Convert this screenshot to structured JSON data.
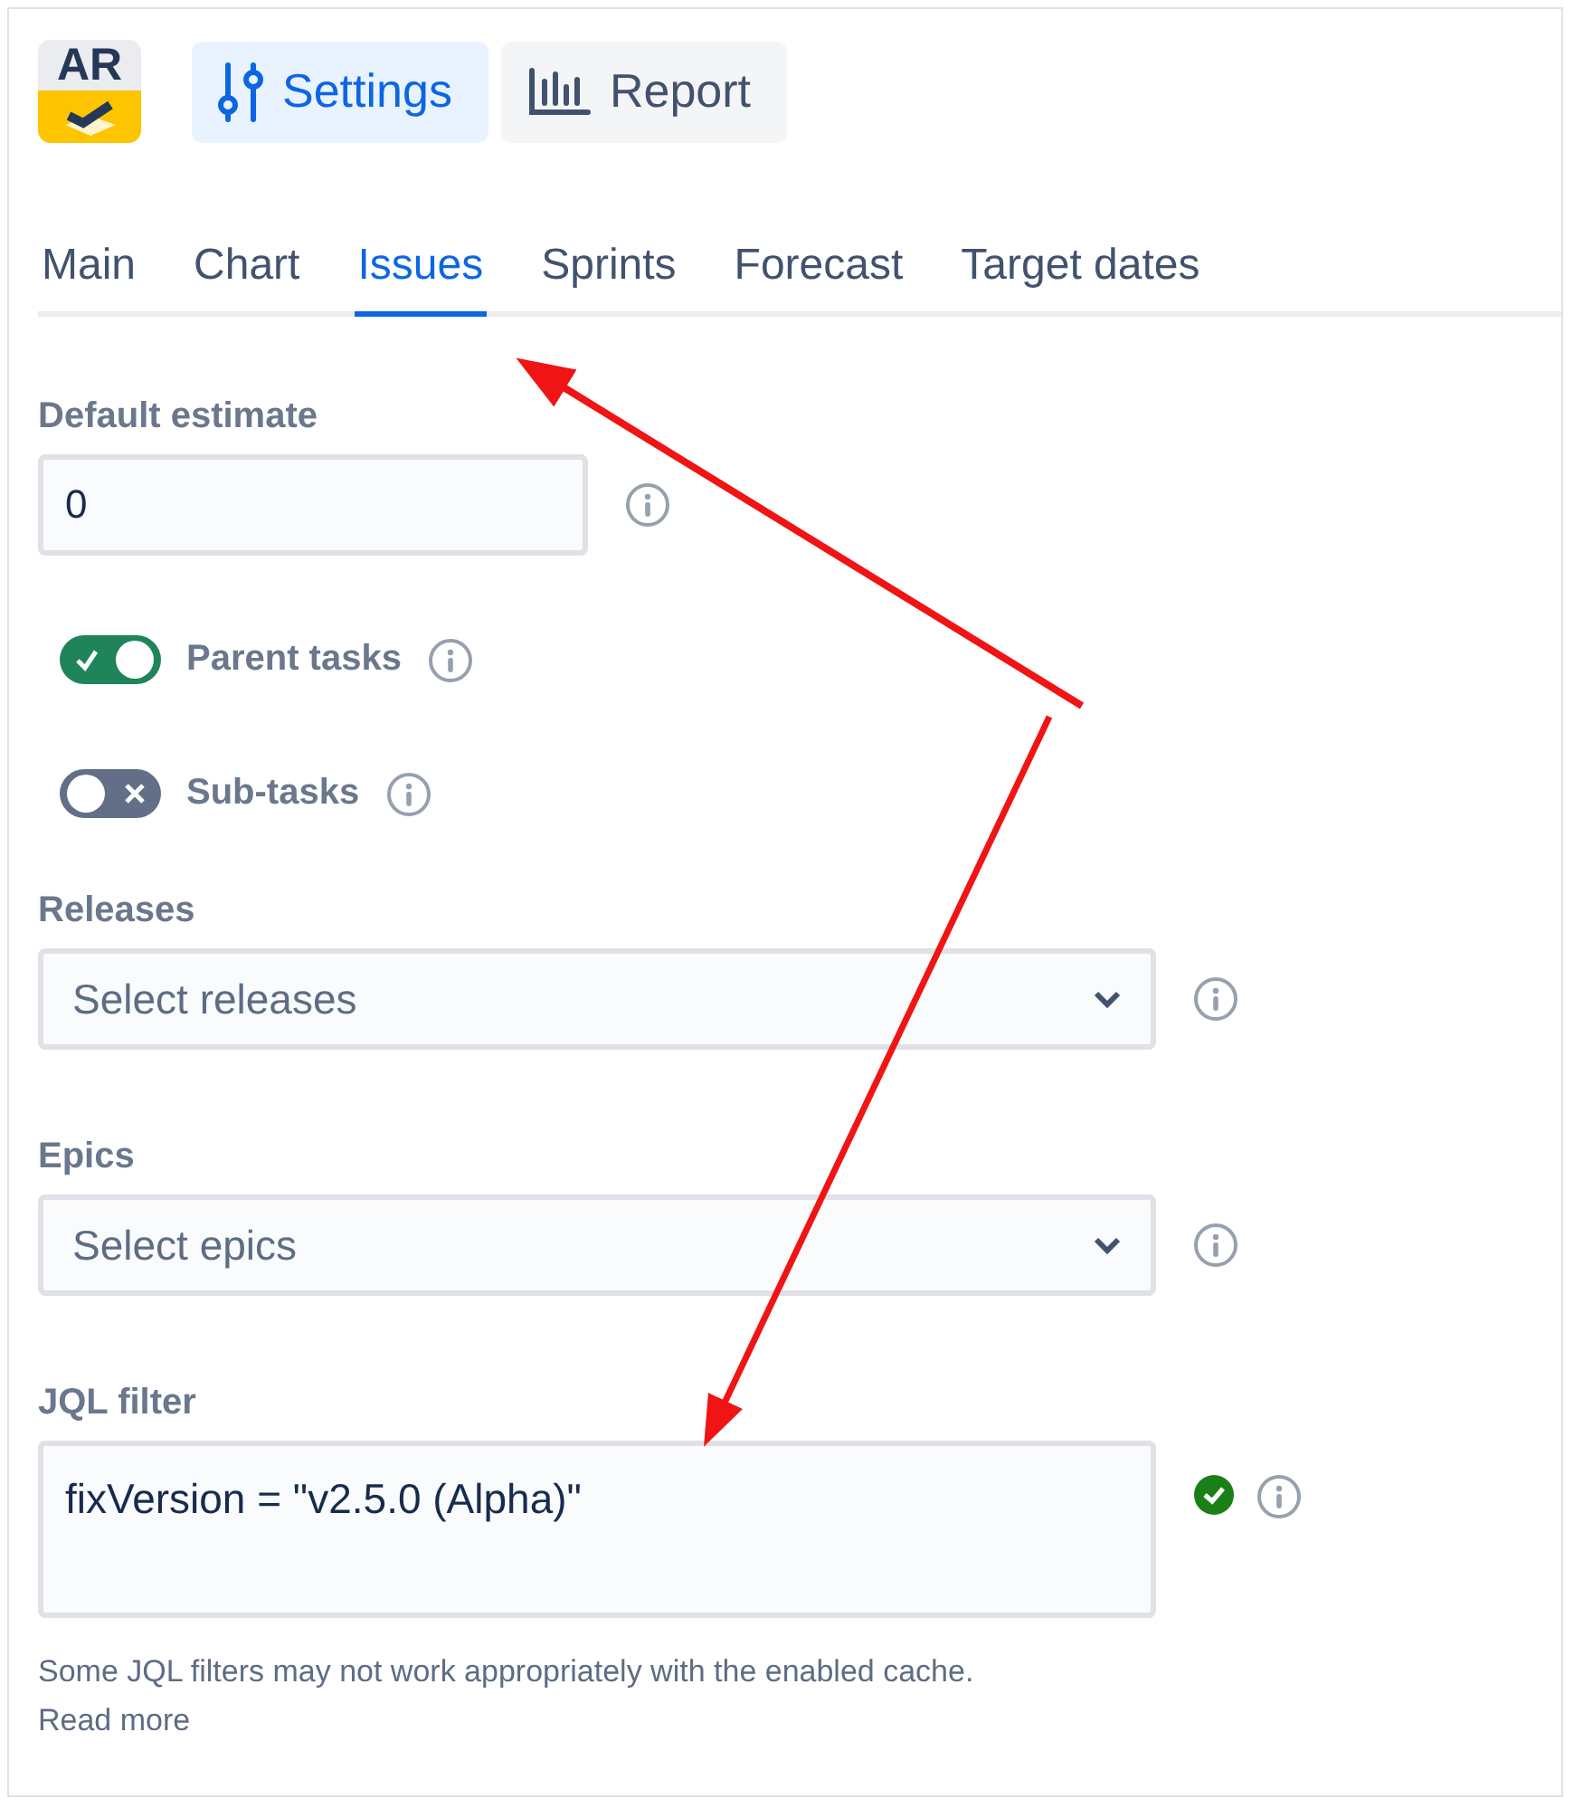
{
  "logo": {
    "text": "AR"
  },
  "view_buttons": [
    {
      "label": "Settings",
      "kind": "settings",
      "selected": true
    },
    {
      "label": "Report",
      "kind": "report",
      "selected": false
    }
  ],
  "tabs": [
    {
      "label": "Main",
      "selected": false
    },
    {
      "label": "Chart",
      "selected": false
    },
    {
      "label": "Issues",
      "selected": true
    },
    {
      "label": "Sprints",
      "selected": false
    },
    {
      "label": "Forecast",
      "selected": false
    },
    {
      "label": "Target dates",
      "selected": false
    }
  ],
  "fields": [
    {
      "kind": "input",
      "label": "Default estimate",
      "value": "0"
    },
    {
      "kind": "toggle",
      "label": "Parent tasks",
      "on": true
    },
    {
      "kind": "toggle",
      "label": "Sub-tasks",
      "on": false
    },
    {
      "kind": "select",
      "label": "Releases",
      "placeholder": "Select releases"
    },
    {
      "kind": "select",
      "label": "Epics",
      "placeholder": "Select epics"
    },
    {
      "kind": "textarea",
      "label": "JQL filter",
      "value": "fixVersion = \"v2.5.0 (Alpha)\"",
      "valid": true
    }
  ],
  "help_text": "Some JQL filters may not work appropriately with the enabled cache.",
  "read_more_link": "Read more"
}
